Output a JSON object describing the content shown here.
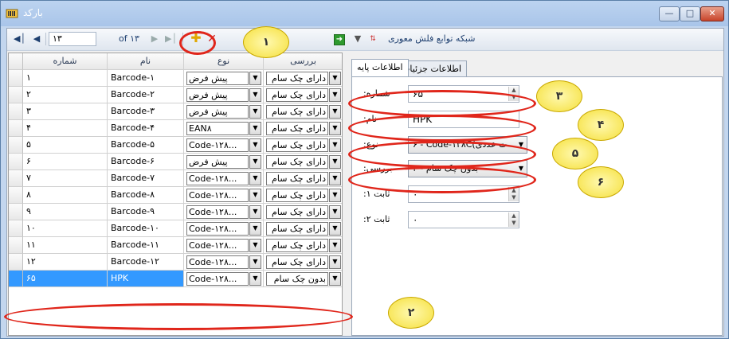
{
  "window": {
    "title": "بارکد",
    "controls": [
      "minimize",
      "maximize",
      "close"
    ]
  },
  "toolbar": {
    "first_icon": "first-record-icon",
    "prev_icon": "prev-record-icon",
    "position": "۱۳",
    "of_total": "of ۱۳",
    "next_icon": "next-record-icon",
    "last_icon": "last-record-icon",
    "add_icon": "add-icon",
    "delete_icon": "delete-icon",
    "right_label": "شبکه توابع فلش معوری",
    "filter_icon": "filter-icon",
    "sort_icon": "sort-icon",
    "export_icon": "export-icon"
  },
  "grid": {
    "columns": [
      "شماره",
      "نام",
      "نوع",
      "بررسی"
    ],
    "rows": [
      {
        "num": "۱",
        "name": "Barcode-۱",
        "type": "پیش فرض",
        "check": "دارای چک سام"
      },
      {
        "num": "۲",
        "name": "Barcode-۲",
        "type": "پیش فرض",
        "check": "دارای چک سام"
      },
      {
        "num": "۳",
        "name": "Barcode-۳",
        "type": "پیش فرض",
        "check": "دارای چک سام"
      },
      {
        "num": "۴",
        "name": "Barcode-۴",
        "type": "EAN۸",
        "check": "دارای چک سام"
      },
      {
        "num": "۵",
        "name": "Barcode-۵",
        "type": "Code-۱۲۸...",
        "check": "دارای چک سام"
      },
      {
        "num": "۶",
        "name": "Barcode-۶",
        "type": "پیش فرض",
        "check": "دارای چک سام"
      },
      {
        "num": "۷",
        "name": "Barcode-۷",
        "type": "Code-۱۲۸...",
        "check": "دارای چک سام"
      },
      {
        "num": "۸",
        "name": "Barcode-۸",
        "type": "Code-۱۲۸...",
        "check": "دارای چک سام"
      },
      {
        "num": "۹",
        "name": "Barcode-۹",
        "type": "Code-۱۲۸...",
        "check": "دارای چک سام"
      },
      {
        "num": "۱۰",
        "name": "Barcode-۱۰",
        "type": "Code-۱۲۸...",
        "check": "دارای چک سام"
      },
      {
        "num": "۱۱",
        "name": "Barcode-۱۱",
        "type": "Code-۱۲۸...",
        "check": "دارای چک سام"
      },
      {
        "num": "۱۲",
        "name": "Barcode-۱۲",
        "type": "Code-۱۲۸...",
        "check": "دارای چک سام"
      },
      {
        "num": "۶۵",
        "name": "HPK",
        "type": "Code-۱۲۸...",
        "check": "بدون چک سام"
      }
    ]
  },
  "tabs": [
    "اطلاعات پایه",
    "اطلاعات جزئیات"
  ],
  "form": {
    "number_label": ":شماره",
    "number_value": "۶۵",
    "name_label": ":نام",
    "name_value": "HPK",
    "type_label": ":نوع",
    "type_value": "۶ - Code-۱۲۸C(ت عددی",
    "check_label": ":بررسی",
    "check_value": "بدون چک سام - ۳",
    "const1_label": ":ثابت ۱",
    "const1_value": "۰",
    "const2_label": ":ثابت ۲",
    "const2_value": "۰"
  },
  "callouts": [
    "۱",
    "۲",
    "۳",
    "۴",
    "۵",
    "۶"
  ],
  "colors": {
    "selection": "#3399ff",
    "annotation_ring": "#e0261b",
    "callout_fill": "#f5df3a"
  }
}
